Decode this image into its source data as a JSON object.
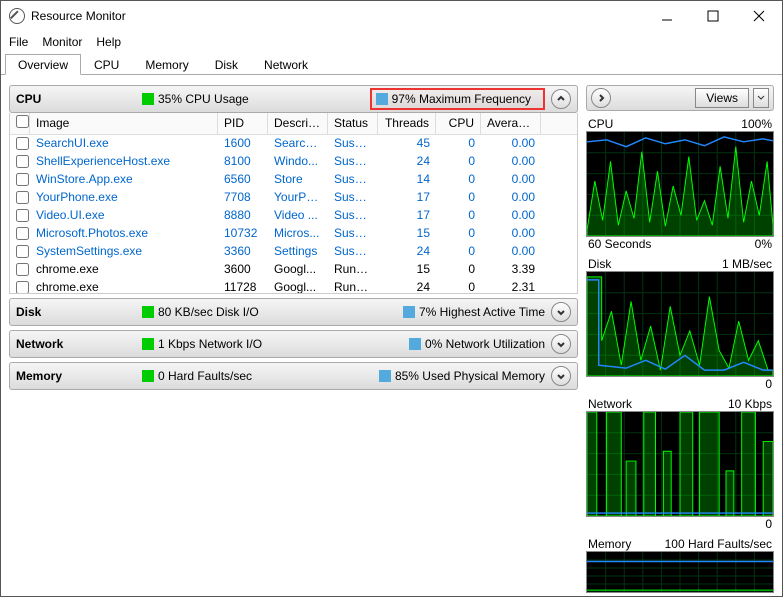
{
  "window": {
    "title": "Resource Monitor"
  },
  "menu": [
    "File",
    "Monitor",
    "Help"
  ],
  "tabs": [
    "Overview",
    "CPU",
    "Memory",
    "Disk",
    "Network"
  ],
  "active_tab": 0,
  "cpu_section": {
    "title": "CPU",
    "stat1": "35% CPU Usage",
    "stat2": "97% Maximum Frequency"
  },
  "columns": [
    "Image",
    "PID",
    "Descrip...",
    "Status",
    "Threads",
    "CPU",
    "Averag..."
  ],
  "rows": [
    {
      "image": "SearchUI.exe",
      "pid": "1600",
      "desc": "Search ...",
      "status": "Suspe...",
      "threads": "45",
      "cpu": "0",
      "avg": "0.00",
      "link": true
    },
    {
      "image": "ShellExperienceHost.exe",
      "pid": "8100",
      "desc": "Windo...",
      "status": "Suspe...",
      "threads": "24",
      "cpu": "0",
      "avg": "0.00",
      "link": true
    },
    {
      "image": "WinStore.App.exe",
      "pid": "6560",
      "desc": "Store",
      "status": "Suspe...",
      "threads": "14",
      "cpu": "0",
      "avg": "0.00",
      "link": true
    },
    {
      "image": "YourPhone.exe",
      "pid": "7708",
      "desc": "YourPh...",
      "status": "Suspe...",
      "threads": "17",
      "cpu": "0",
      "avg": "0.00",
      "link": true
    },
    {
      "image": "Video.UI.exe",
      "pid": "8880",
      "desc": "Video ...",
      "status": "Suspe...",
      "threads": "17",
      "cpu": "0",
      "avg": "0.00",
      "link": true
    },
    {
      "image": "Microsoft.Photos.exe",
      "pid": "10732",
      "desc": "Micros...",
      "status": "Suspe...",
      "threads": "15",
      "cpu": "0",
      "avg": "0.00",
      "link": true
    },
    {
      "image": "SystemSettings.exe",
      "pid": "3360",
      "desc": "Settings",
      "status": "Suspe...",
      "threads": "24",
      "cpu": "0",
      "avg": "0.00",
      "link": true
    },
    {
      "image": "chrome.exe",
      "pid": "3600",
      "desc": "Googl...",
      "status": "Runni...",
      "threads": "15",
      "cpu": "0",
      "avg": "3.39",
      "link": false
    },
    {
      "image": "chrome.exe",
      "pid": "11728",
      "desc": "Googl...",
      "status": "Runni...",
      "threads": "24",
      "cpu": "0",
      "avg": "2.31",
      "link": false
    }
  ],
  "disk_section": {
    "title": "Disk",
    "stat1": "80 KB/sec Disk I/O",
    "stat2": "7% Highest Active Time"
  },
  "network_section": {
    "title": "Network",
    "stat1": "1 Kbps Network I/O",
    "stat2": "0% Network Utilization"
  },
  "memory_section": {
    "title": "Memory",
    "stat1": "0 Hard Faults/sec",
    "stat2": "85% Used Physical Memory"
  },
  "views_label": "Views",
  "graphs": [
    {
      "title": "CPU",
      "value": "100%",
      "foot_l": "60 Seconds",
      "foot_r": "0%"
    },
    {
      "title": "Disk",
      "value": "1 MB/sec",
      "foot_l": "",
      "foot_r": "0"
    },
    {
      "title": "Network",
      "value": "10 Kbps",
      "foot_l": "",
      "foot_r": "0"
    },
    {
      "title": "Memory",
      "value": "100 Hard Faults/sec",
      "foot_l": "",
      "foot_r": ""
    }
  ]
}
